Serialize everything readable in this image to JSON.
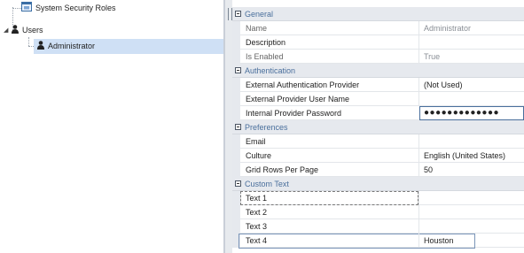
{
  "tree": {
    "root_label": "System Security Roles",
    "users_label": "Users",
    "admin_label": "Administrator"
  },
  "grid": {
    "general": {
      "header": "General",
      "name_label": "Name",
      "name_value": "Administrator",
      "description_label": "Description",
      "description_value": "",
      "enabled_label": "Is Enabled",
      "enabled_value": "True"
    },
    "authentication": {
      "header": "Authentication",
      "ext_provider_label": "External Authentication Provider",
      "ext_provider_value": "(Not Used)",
      "ext_user_label": "External Provider User Name",
      "ext_user_value": "",
      "int_password_label": "Internal Provider Password",
      "int_password_value": "●●●●●●●●●●●●●"
    },
    "preferences": {
      "header": "Preferences",
      "email_label": "Email",
      "email_value": "",
      "culture_label": "Culture",
      "culture_value": "English (United States)",
      "rows_label": "Grid Rows Per Page",
      "rows_value": "50"
    },
    "custom_text": {
      "header": "Custom Text",
      "text1_label": "Text 1",
      "text1_value": "",
      "text2_label": "Text 2",
      "text2_value": "",
      "text3_label": "Text 3",
      "text3_value": "",
      "text4_label": "Text 4",
      "text4_value": "Houston"
    }
  }
}
